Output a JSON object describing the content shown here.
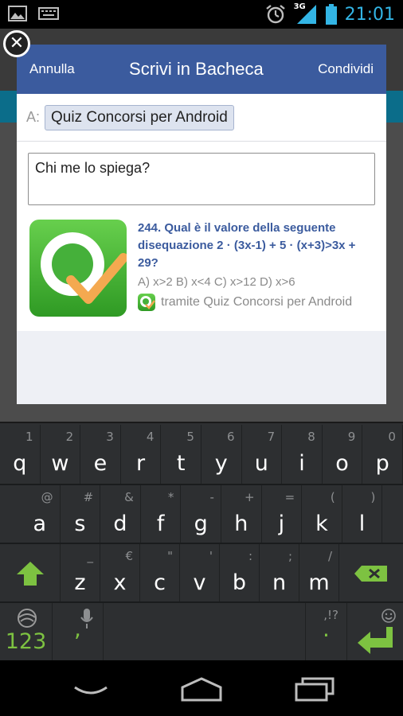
{
  "status_bar": {
    "time": "21:01",
    "network": "3G",
    "icons": [
      "gallery-icon",
      "keyboard-icon",
      "alarm-icon",
      "signal-icon",
      "battery-icon"
    ]
  },
  "dialog": {
    "cancel_label": "Annulla",
    "title": "Scrivi in Bacheca",
    "share_label": "Condividi",
    "to_label": "A:",
    "to_value": "Quiz Concorsi per Android",
    "message": "Chi me lo spiega?",
    "attachment": {
      "title": "244. Qual è il valore della seguente disequazione 2 · (3x-1) + 5 · (x+3)>3x + 29?",
      "description": "A) x>2 B) x<4 C) x>12 D) x>6",
      "via": "tramite Quiz Concorsi per Android"
    }
  },
  "keyboard": {
    "row1": [
      {
        "main": "q",
        "alt": "1"
      },
      {
        "main": "w",
        "alt": "2"
      },
      {
        "main": "e",
        "alt": "3"
      },
      {
        "main": "r",
        "alt": "4"
      },
      {
        "main": "t",
        "alt": "5"
      },
      {
        "main": "y",
        "alt": "6"
      },
      {
        "main": "u",
        "alt": "7"
      },
      {
        "main": "i",
        "alt": "8"
      },
      {
        "main": "o",
        "alt": "9"
      },
      {
        "main": "p",
        "alt": "0"
      }
    ],
    "row2": [
      {
        "main": "a",
        "alt": "@"
      },
      {
        "main": "s",
        "alt": "#"
      },
      {
        "main": "d",
        "alt": "&"
      },
      {
        "main": "f",
        "alt": "*"
      },
      {
        "main": "g",
        "alt": "-"
      },
      {
        "main": "h",
        "alt": "+"
      },
      {
        "main": "j",
        "alt": "="
      },
      {
        "main": "k",
        "alt": "("
      },
      {
        "main": "l",
        "alt": ")"
      }
    ],
    "row3": [
      {
        "main": "z",
        "alt": "_"
      },
      {
        "main": "x",
        "alt": "€"
      },
      {
        "main": "c",
        "alt": "\""
      },
      {
        "main": "v",
        "alt": "'"
      },
      {
        "main": "b",
        "alt": ":"
      },
      {
        "main": "n",
        "alt": ";"
      },
      {
        "main": "m",
        "alt": "/"
      }
    ],
    "num_label": "123",
    "comma": ",",
    "period": ".",
    "punct_alt": ",!?",
    "accent_color": "#7dc241"
  },
  "colors": {
    "facebook_blue": "#3b5b9e",
    "android_blue": "#33b5e5",
    "keyboard_green": "#7dc241"
  }
}
